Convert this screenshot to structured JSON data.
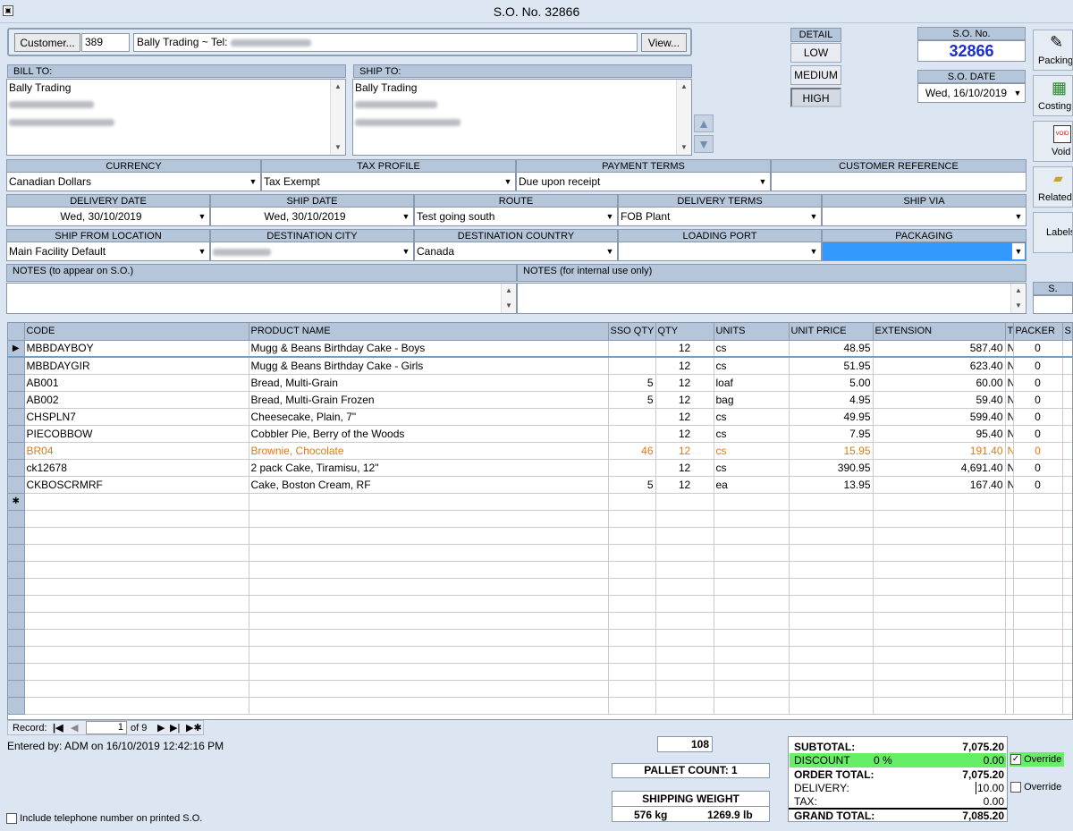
{
  "window": {
    "title": "S.O. No. 32866"
  },
  "customer": {
    "button": "Customer...",
    "id": "389",
    "name_tel": "Bally Trading  ~  Tel:",
    "view_button": "View..."
  },
  "bill_to": {
    "label": "BILL TO:",
    "name": "Bally Trading"
  },
  "ship_to": {
    "label": "SHIP TO:",
    "name": "Bally Trading"
  },
  "detail": {
    "label": "DETAIL",
    "low": "LOW",
    "medium": "MEDIUM",
    "high": "HIGH",
    "selected": "HIGH"
  },
  "so": {
    "no_label": "S.O. No.",
    "no_value": "32866",
    "date_label": "S.O. DATE",
    "date_value": "Wed, 16/10/2019"
  },
  "side_buttons": [
    "Packing",
    "Costing",
    "Void",
    "Related",
    "Labels",
    "S."
  ],
  "row1": {
    "currency_label": "CURRENCY",
    "currency": "Canadian Dollars",
    "tax_label": "TAX PROFILE",
    "tax": "Tax Exempt",
    "payment_label": "PAYMENT TERMS",
    "payment": "Due upon receipt",
    "custref_label": "CUSTOMER REFERENCE",
    "custref": ""
  },
  "row2": {
    "delivery_date_label": "DELIVERY DATE",
    "delivery_date": "Wed, 30/10/2019",
    "ship_date_label": "SHIP DATE",
    "ship_date": "Wed, 30/10/2019",
    "route_label": "ROUTE",
    "route": "Test going south",
    "delivery_terms_label": "DELIVERY TERMS",
    "delivery_terms": "FOB Plant",
    "ship_via_label": "SHIP VIA",
    "ship_via": ""
  },
  "row3": {
    "ship_from_label": "SHIP FROM LOCATION",
    "ship_from": "Main Facility Default",
    "dest_city_label": "DESTINATION CITY",
    "dest_country_label": "DESTINATION COUNTRY",
    "dest_country": "Canada",
    "loading_port_label": "LOADING PORT",
    "packaging_label": "PACKAGING"
  },
  "notes": {
    "so_label": "NOTES (to appear on S.O.)",
    "internal_label": "NOTES (for internal use only)"
  },
  "grid": {
    "columns": {
      "code": "CODE",
      "product": "PRODUCT NAME",
      "sso": "SSO QTY",
      "qty": "QTY",
      "units": "UNITS",
      "price": "UNIT PRICE",
      "ext": "EXTENSION",
      "t": "T.",
      "packer": "PACKER",
      "s": "S"
    },
    "rows": [
      {
        "code": "MBBDAYBOY",
        "product": "Mugg & Beans Birthday Cake - Boys",
        "sso": "",
        "qty": "12",
        "units": "cs",
        "price": "48.95",
        "ext": "587.40",
        "t": "N..",
        "packer": "0"
      },
      {
        "code": "MBBDAYGIR",
        "product": "Mugg & Beans Birthday Cake - Girls",
        "sso": "",
        "qty": "12",
        "units": "cs",
        "price": "51.95",
        "ext": "623.40",
        "t": "N..",
        "packer": "0"
      },
      {
        "code": "AB001",
        "product": "Bread, Multi-Grain",
        "sso": "5",
        "qty": "12",
        "units": "loaf",
        "price": "5.00",
        "ext": "60.00",
        "t": "N..",
        "packer": "0"
      },
      {
        "code": "AB002",
        "product": "Bread, Multi-Grain Frozen",
        "sso": "5",
        "qty": "12",
        "units": "bag",
        "price": "4.95",
        "ext": "59.40",
        "t": "N..",
        "packer": "0"
      },
      {
        "code": "CHSPLN7",
        "product": "Cheesecake, Plain, 7\"",
        "sso": "",
        "qty": "12",
        "units": "cs",
        "price": "49.95",
        "ext": "599.40",
        "t": "N..",
        "packer": "0"
      },
      {
        "code": "PIECOBBOW",
        "product": "Cobbler Pie, Berry of the Woods",
        "sso": "",
        "qty": "12",
        "units": "cs",
        "price": "7.95",
        "ext": "95.40",
        "t": "N..",
        "packer": "0"
      },
      {
        "code": "BR04",
        "product": "Brownie, Chocolate",
        "sso": "46",
        "qty": "12",
        "units": "cs",
        "price": "15.95",
        "ext": "191.40",
        "t": "N..",
        "packer": "0",
        "highlight": "#e07a10"
      },
      {
        "code": "ck12678",
        "product": "2 pack Cake, Tiramisu, 12\"",
        "sso": "",
        "qty": "12",
        "units": "cs",
        "price": "390.95",
        "ext": "4,691.40",
        "t": "N..",
        "packer": "0"
      },
      {
        "code": "CKBOSCRMRF",
        "product": "Cake, Boston Cream, RF",
        "sso": "5",
        "qty": "12",
        "units": "ea",
        "price": "13.95",
        "ext": "167.40",
        "t": "N..",
        "packer": "0"
      }
    ]
  },
  "nav": {
    "label": "Record:",
    "current": "1",
    "of": "of 9"
  },
  "footer": {
    "entered_by": "Entered by: ADM on 16/10/2019 12:42:16 PM",
    "qty_total": "108",
    "pallet_count": "PALLET COUNT: 1",
    "shipping_weight_label": "SHIPPING WEIGHT",
    "kg": "576 kg",
    "lb": "1269.9 lb",
    "include_tel": "Include telephone number on printed S.O."
  },
  "totals": {
    "subtotal_label": "SUBTOTAL:",
    "subtotal": "7,075.20",
    "discount_label": "DISCOUNT",
    "discount_pct": "0 %",
    "discount": "0.00",
    "order_total_label": "ORDER TOTAL:",
    "order_total": "7,075.20",
    "delivery_label": "DELIVERY:",
    "delivery": "10.00",
    "tax_label": "TAX:",
    "tax": "0.00",
    "grand_label": "GRAND TOTAL:",
    "grand": "7,085.20",
    "override1": "Override",
    "override2": "Override"
  },
  "colors": {
    "highlight_row": "#e07a10",
    "discount_bg": "#66ee66",
    "packaging_field": "#3399ff",
    "so_number": "#1a2ecc"
  }
}
